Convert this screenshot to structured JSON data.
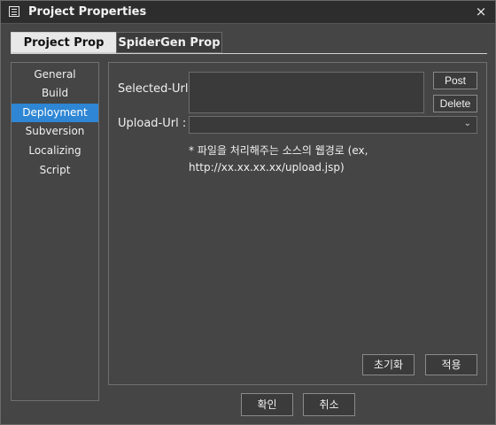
{
  "window": {
    "title": "Project Properties",
    "close_label": "×"
  },
  "tabs": [
    {
      "label": "Project Prop",
      "selected": true
    },
    {
      "label": "SpiderGen Prop",
      "selected": false
    }
  ],
  "sidebar": {
    "items": [
      {
        "label": "General"
      },
      {
        "label": "Build"
      },
      {
        "label": "Deployment",
        "selected": true
      },
      {
        "label": "Subversion"
      },
      {
        "label": "Localizing"
      },
      {
        "label": "Script"
      }
    ]
  },
  "deployment": {
    "selected_url_label": "Selected-Url :",
    "upload_url_label": "Upload-Url :",
    "selected_url_value": "",
    "upload_url_value": "",
    "post_label": "Post",
    "delete_label": "Delete",
    "note_line1": "* 파일을 처리해주는 소스의 웹경로 (ex,",
    "note_line2": "http://xx.xx.xx.xx/upload.jsp)",
    "reset_label": "초기화",
    "apply_label": "적용"
  },
  "footer": {
    "ok_label": "확인",
    "cancel_label": "취소"
  }
}
